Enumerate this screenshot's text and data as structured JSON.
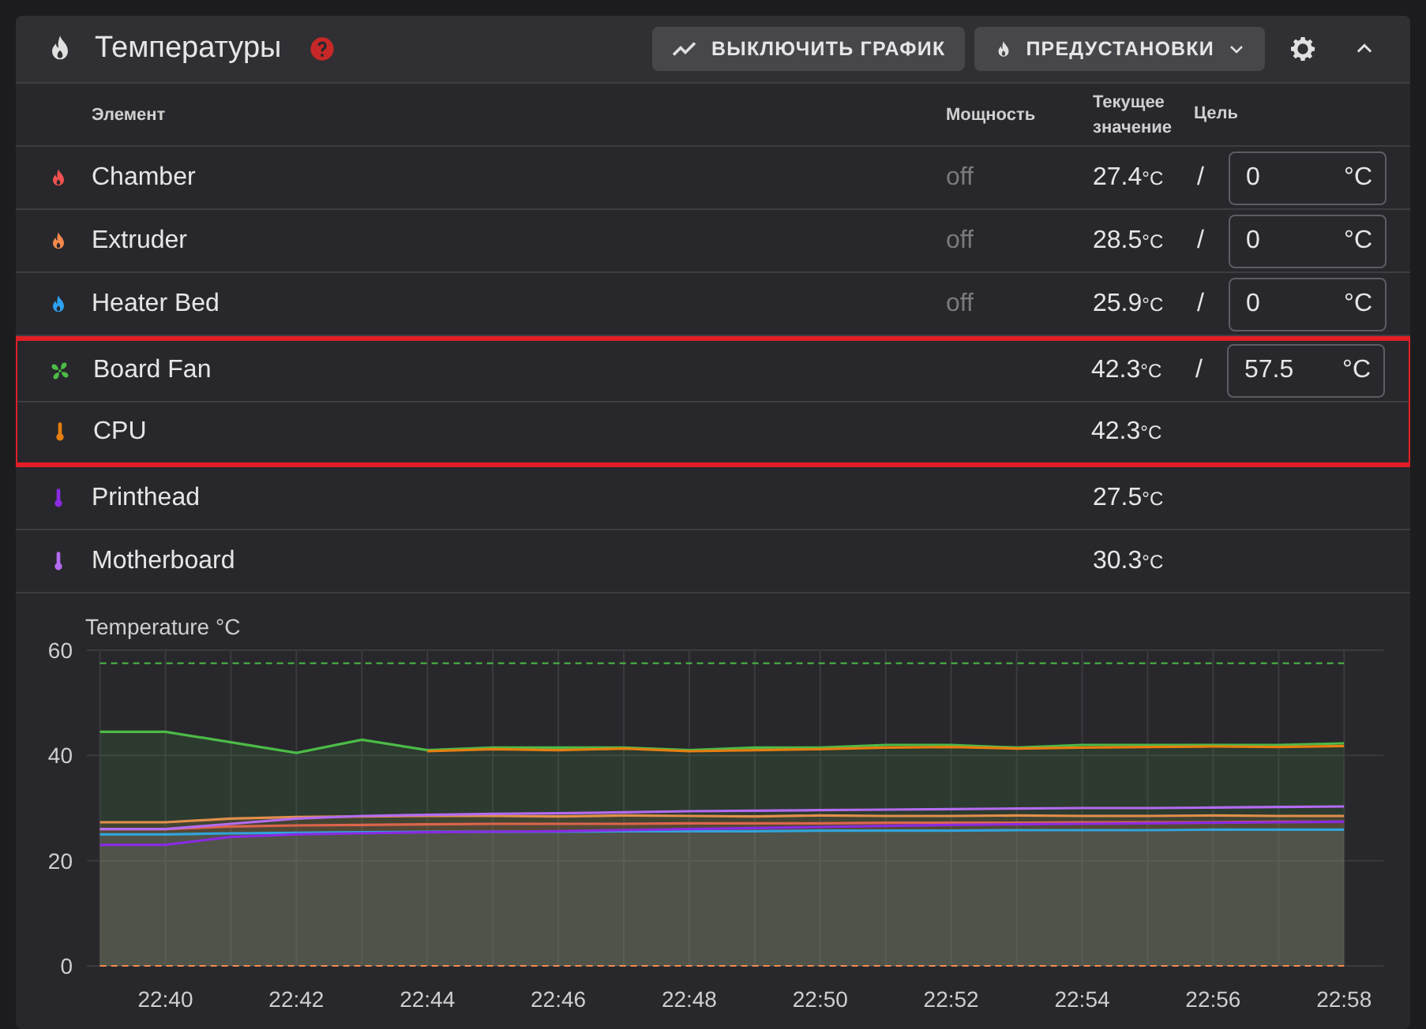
{
  "panel": {
    "title": "Температуры",
    "help": true,
    "buttons": [
      {
        "kind": "chart",
        "label": "ВЫКЛЮЧИТЬ ГРАФИК"
      },
      {
        "kind": "presets",
        "label": "ПРЕДУСТАНОВКИ"
      }
    ],
    "expanded": true
  },
  "table": {
    "columns": [
      "Элемент",
      "Мощность",
      "Текущее значение",
      "Цель"
    ],
    "rows": [
      {
        "kind": "heater",
        "color": "#f0524f",
        "name": "Chamber",
        "power": "off",
        "current": "27.4",
        "unit": "°C",
        "separator": "/",
        "target": "0",
        "target_unit": "°C",
        "highlighted": false
      },
      {
        "kind": "heater",
        "color": "#f6894d",
        "name": "Extruder",
        "power": "off",
        "current": "28.5",
        "unit": "°C",
        "separator": "/",
        "target": "0",
        "target_unit": "°C",
        "highlighted": false
      },
      {
        "kind": "heater",
        "color": "#2ea1f0",
        "name": "Heater Bed",
        "power": "off",
        "current": "25.9",
        "unit": "°C",
        "separator": "/",
        "target": "0",
        "target_unit": "°C",
        "highlighted": false
      },
      {
        "kind": "fan",
        "color": "#4cbb47",
        "name": "Board Fan",
        "current": "42.3",
        "unit": "°C",
        "separator": "/",
        "target": "57.5",
        "target_unit": "°C",
        "highlighted": true
      },
      {
        "kind": "sensor",
        "color": "#e67e10",
        "name": "CPU",
        "current": "42.3",
        "unit": "°C",
        "highlighted": true
      },
      {
        "kind": "sensor",
        "color": "#8a2be2",
        "name": "Printhead",
        "current": "27.5",
        "unit": "°C",
        "highlighted": false
      },
      {
        "kind": "sensor",
        "color": "#b36bf0",
        "name": "Motherboard",
        "current": "30.3",
        "unit": "°C",
        "highlighted": false
      }
    ]
  },
  "chart": {
    "chart_data": {
      "type": "line",
      "ylabel": "Temperature °C",
      "ylim": [
        0,
        60
      ],
      "yticks": [
        0,
        20,
        40,
        60
      ],
      "grid": true,
      "categories": [
        null,
        "22:40",
        null,
        "22:42",
        null,
        "22:44",
        null,
        "22:46",
        null,
        "22:48",
        null,
        "22:50",
        null,
        "22:52",
        null,
        "22:54",
        null,
        "22:56",
        null,
        "22:58"
      ],
      "series": [
        {
          "type": "area",
          "color": "#f0524f",
          "values": [
            26,
            26,
            26.5,
            26.7,
            26.8,
            26.9,
            27,
            27,
            27,
            27.1,
            27.1,
            27.1,
            27.2,
            27.2,
            27.2,
            27.3,
            27.3,
            27.3,
            27.4,
            27.4
          ]
        },
        {
          "type": "area",
          "color": "#f6894d",
          "values": [
            27.3,
            27.3,
            28,
            28.3,
            28.4,
            28.5,
            28.5,
            28.4,
            28.6,
            28.5,
            28.4,
            28.6,
            28.5,
            28.5,
            28.6,
            28.5,
            28.5,
            28.6,
            28.5,
            28.5
          ]
        },
        {
          "type": "area",
          "color": "#2ea1f0",
          "values": [
            25,
            25,
            25.2,
            25.3,
            25.4,
            25.5,
            25.5,
            25.5,
            25.6,
            25.6,
            25.6,
            25.7,
            25.7,
            25.7,
            25.8,
            25.8,
            25.8,
            25.9,
            25.9,
            25.9
          ]
        },
        {
          "type": "area",
          "color": "#4cbb47",
          "values": [
            44.5,
            44.5,
            42.5,
            40.5,
            43,
            41,
            41.5,
            41.5,
            41.5,
            41,
            41.5,
            41.5,
            42,
            42,
            41.5,
            42,
            42,
            42,
            42,
            42.3
          ]
        },
        {
          "type": "line",
          "color": "#e67e10",
          "values": [
            null,
            null,
            null,
            null,
            null,
            40.8,
            41.2,
            41,
            41.3,
            40.8,
            41,
            41.2,
            41.5,
            41.6,
            41.3,
            41.5,
            41.6,
            41.7,
            41.6,
            41.8
          ]
        },
        {
          "type": "line",
          "color": "#8a2be2",
          "values": [
            23,
            23,
            24.5,
            25,
            25.2,
            25.4,
            25.5,
            25.6,
            25.8,
            26,
            26.2,
            26.4,
            26.6,
            26.8,
            26.9,
            27,
            27.1,
            27.2,
            27.3,
            27.4
          ]
        },
        {
          "type": "line",
          "color": "#b36bf0",
          "values": [
            26,
            26,
            27,
            28,
            28.5,
            28.7,
            28.9,
            29,
            29.2,
            29.4,
            29.5,
            29.6,
            29.7,
            29.8,
            29.9,
            30,
            30,
            30.1,
            30.2,
            30.3
          ]
        },
        {
          "line_style": "dashed",
          "type": "line",
          "color": "#4cbb47",
          "values": [
            57.5,
            57.5,
            57.5,
            57.5,
            57.5,
            57.5,
            57.5,
            57.5,
            57.5,
            57.5,
            57.5,
            57.5,
            57.5,
            57.5,
            57.5,
            57.5,
            57.5,
            57.5,
            57.5,
            57.5
          ]
        },
        {
          "line_style": "dashed",
          "type": "line",
          "color": "#f6894d",
          "values": [
            0,
            0,
            0,
            0,
            0,
            0,
            0,
            0,
            0,
            0,
            0,
            0,
            0,
            0,
            0,
            0,
            0,
            0,
            0,
            0
          ]
        }
      ]
    }
  }
}
